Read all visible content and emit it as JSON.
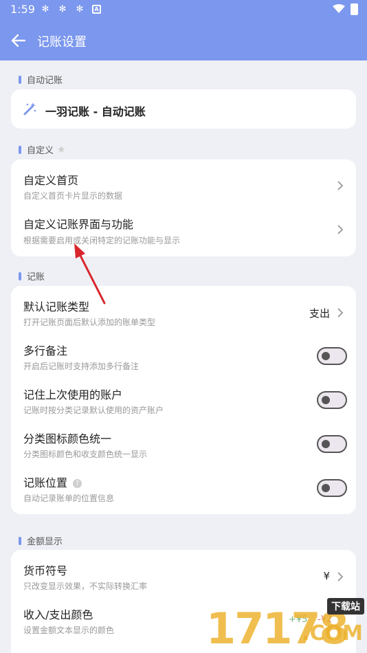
{
  "status_bar": {
    "time": "1:59"
  },
  "header": {
    "title": "记账设置"
  },
  "sections": {
    "auto": {
      "label": "自动记账",
      "item": "一羽记账 - 自动记账"
    },
    "custom": {
      "label": "自定义",
      "items": [
        {
          "title": "自定义首页",
          "subtitle": "自定义首页卡片显示的数据"
        },
        {
          "title": "自定义记账界面与功能",
          "subtitle": "根据需要启用或关闭特定的记账功能与显示"
        }
      ]
    },
    "bookkeeping": {
      "label": "记账",
      "items": [
        {
          "title": "默认记账类型",
          "subtitle": "打开记账页面后默认添加的账单类型",
          "value": "支出"
        },
        {
          "title": "多行备注",
          "subtitle": "开启后记账时支持添加多行备注",
          "toggle": false
        },
        {
          "title": "记住上次使用的账户",
          "subtitle": "记账时按分类记录默认使用的资产账户",
          "toggle": false
        },
        {
          "title": "分类图标颜色统一",
          "subtitle": "分类图标颜色和收支颜色统一显示",
          "toggle": false
        },
        {
          "title": "记账位置",
          "subtitle": "自动记录账单的位置信息",
          "toggle": false
        }
      ]
    },
    "amount": {
      "label": "金额显示",
      "items": [
        {
          "title": "货币符号",
          "subtitle": "只改变显示效果，不实际转换汇率",
          "value": "¥"
        },
        {
          "title": "收入/支出颜色",
          "subtitle": "设置金额文本显示的颜色",
          "value_left": "+¥5",
          "value_right": "-¥2"
        }
      ]
    }
  },
  "watermark": {
    "digits": "17178",
    "badge": "下载站",
    "domain": ".COM"
  },
  "colors": {
    "accent": "#7b97ee",
    "background": "#eef0f5",
    "card": "#ffffff",
    "annotation_arrow": "#d8262c"
  }
}
